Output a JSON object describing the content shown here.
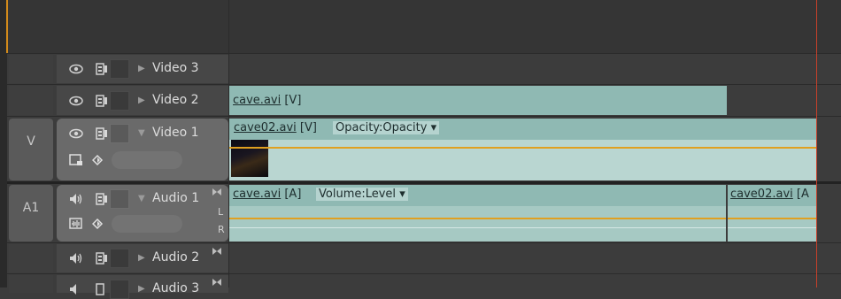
{
  "tracks": {
    "video3": {
      "name": "Video 3"
    },
    "video2": {
      "name": "Video 2"
    },
    "video1": {
      "name": "Video 1",
      "target": "V"
    },
    "audio1": {
      "name": "Audio 1",
      "target": "A1",
      "channel_left": "L",
      "channel_right": "R"
    },
    "audio2": {
      "name": "Audio 2"
    },
    "audio3": {
      "name": "Audio 3"
    }
  },
  "clips": {
    "video2_clip": {
      "name": "cave.avi",
      "suffix": "[V]"
    },
    "video1_clip": {
      "name": "cave02.avi",
      "suffix": "[V]",
      "effect": "Opacity:Opacity"
    },
    "audio1_clip1": {
      "name": "cave.avi",
      "suffix": "[A]",
      "effect": "Volume:Level"
    },
    "audio1_clip2": {
      "name": "cave02.avi",
      "suffix": "[A"
    }
  },
  "icons": {
    "visibility": "eye-icon",
    "sync_lock": "sync-lock-icon",
    "speaker": "speaker-icon",
    "keyframe": "keyframe-diamond-icon"
  },
  "colors": {
    "clip": "#8fb9b3",
    "playhead": "#c8402a",
    "keyframe_line": "#e0a020"
  }
}
